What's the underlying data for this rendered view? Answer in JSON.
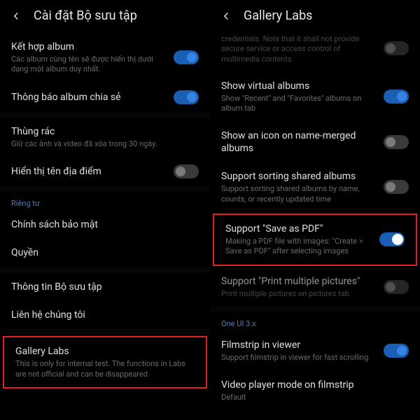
{
  "left": {
    "title": "Cài đặt Bộ sưu tập",
    "items": {
      "combine": {
        "title": "Kết hợp album",
        "desc": "Các album cùng tên sẽ được hiển thị dưới dạng một album duy nhất."
      },
      "shared_notif": {
        "title": "Thông báo album chia sẻ"
      },
      "trash": {
        "title": "Thùng rác",
        "desc": "Giữ các ảnh và video đã xóa trong 30 ngày."
      },
      "location": {
        "title": "Hiển thị tên địa điểm"
      },
      "section_privacy": "Riêng tư",
      "privacy_policy": {
        "title": "Chính sách bảo mật"
      },
      "permissions": {
        "title": "Quyền"
      },
      "about": {
        "title": "Thông tin Bộ sưu tập"
      },
      "contact": {
        "title": "Liên hệ chúng tôi"
      },
      "gallery_labs": {
        "title": "Gallery Labs",
        "desc": "This is only for internal test. The functions in Labs are not official and can be disappeared"
      }
    }
  },
  "right": {
    "title": "Gallery Labs",
    "items": {
      "creds": {
        "desc": "credentials. Note that it shall not provide secure service or access control of multimedia contents."
      },
      "virtual": {
        "title": "Show virtual albums",
        "desc": "Show \"Recent\" and \"Favorites\" albums on album tab"
      },
      "merged_icon": {
        "title": "Show an icon on name-merged albums"
      },
      "sorting": {
        "title": "Support sorting shared albums",
        "desc": "Support sorting shared albums by name, counts, or recently updated time"
      },
      "save_pdf": {
        "title": "Support \"Save as PDF\"",
        "desc": "Making a PDF file with images: \"Create > Save as PDF\" after selecting images"
      },
      "print_multi": {
        "title": "Support \"Print multiple pictures\"",
        "desc": "Print multiple pictures on pictures tab"
      },
      "section_oneui": "One UI 3.x",
      "filmstrip": {
        "title": "Filmstrip in viewer",
        "desc": "Support filmstrip in viewer for fast scrolling"
      },
      "video_mode": {
        "title": "Video player mode on filmstrip",
        "desc": "Default"
      }
    }
  }
}
